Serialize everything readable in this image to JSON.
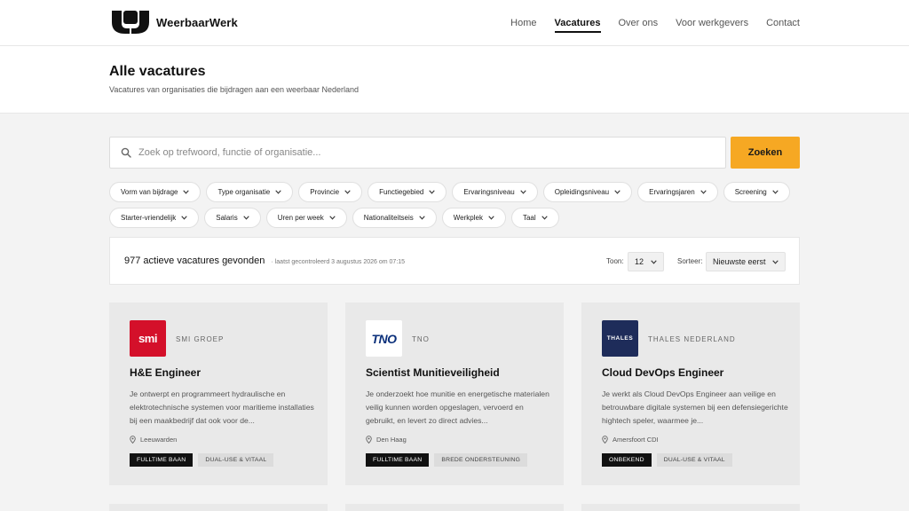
{
  "brand": {
    "name": "WeerbaarWerk"
  },
  "nav": {
    "items": [
      {
        "label": "Home",
        "active": false
      },
      {
        "label": "Vacatures",
        "active": true
      },
      {
        "label": "Over ons",
        "active": false
      },
      {
        "label": "Voor werkgevers",
        "active": false
      },
      {
        "label": "Contact",
        "active": false
      }
    ]
  },
  "page": {
    "title": "Alle vacatures",
    "subtitle": "Vacatures van organisaties die bijdragen aan een weerbaar Nederland"
  },
  "search": {
    "placeholder": "Zoek op trefwoord, functie of organisatie...",
    "button_label": "Zoeken"
  },
  "filters": [
    "Vorm van bijdrage",
    "Type organisatie",
    "Provincie",
    "Functiegebied",
    "Ervaringsniveau",
    "Opleidingsniveau",
    "Ervaringsjaren",
    "Screening",
    "Starter-vriendelijk",
    "Salaris",
    "Uren per week",
    "Nationaliteitseis",
    "Werkplek",
    "Taal"
  ],
  "results": {
    "count_text": "977 actieve vacatures gevonden",
    "checked_text": "· laatst gecontroleerd 3 augustus 2026 om 07:15",
    "show_label": "Toon:",
    "show_value": "12",
    "sort_label": "Sorteer:",
    "sort_value": "Nieuwste eerst"
  },
  "jobs": [
    {
      "org": "SMI GROEP",
      "logo_text": "smi",
      "title": "H&E Engineer",
      "description": "Je ontwerpt en programmeert hydraulische en elektrotechnische systemen voor maritieme installaties bij een maakbedrijf dat ook voor de...",
      "location": "Leeuwarden",
      "tags": [
        {
          "label": "FULLTIME BAAN",
          "style": "dark"
        },
        {
          "label": "DUAL-USE & VITAAL",
          "style": "light"
        }
      ]
    },
    {
      "org": "TNO",
      "logo_text": "TNO",
      "title": "Scientist Munitieveiligheid",
      "description": "Je onderzoekt hoe munitie en energetische materialen veilig kunnen worden opgeslagen, vervoerd en gebruikt, en levert zo direct advies...",
      "location": "Den Haag",
      "tags": [
        {
          "label": "FULLTIME BAAN",
          "style": "dark"
        },
        {
          "label": "BREDE ONDERSTEUNING",
          "style": "light"
        }
      ]
    },
    {
      "org": "THALES NEDERLAND",
      "logo_text": "THALES",
      "title": "Cloud DevOps Engineer",
      "description": "Je werkt als Cloud DevOps Engineer aan veilige en betrouwbare digitale systemen bij een defensiegerichte hightech speler, waarmee je...",
      "location": "Amersfoort CDI",
      "tags": [
        {
          "label": "ONBEKEND",
          "style": "dark"
        },
        {
          "label": "DUAL-USE & VITAAL",
          "style": "light"
        }
      ]
    }
  ],
  "colors": {
    "accent": "#f6a823",
    "smi_red": "#d4102a",
    "tno_blue": "#0a2f7a",
    "thales_navy": "#1e2c5a"
  },
  "icons": [
    "logo-mark-icon",
    "search-icon",
    "chevron-down-icon",
    "location-pin-icon"
  ]
}
